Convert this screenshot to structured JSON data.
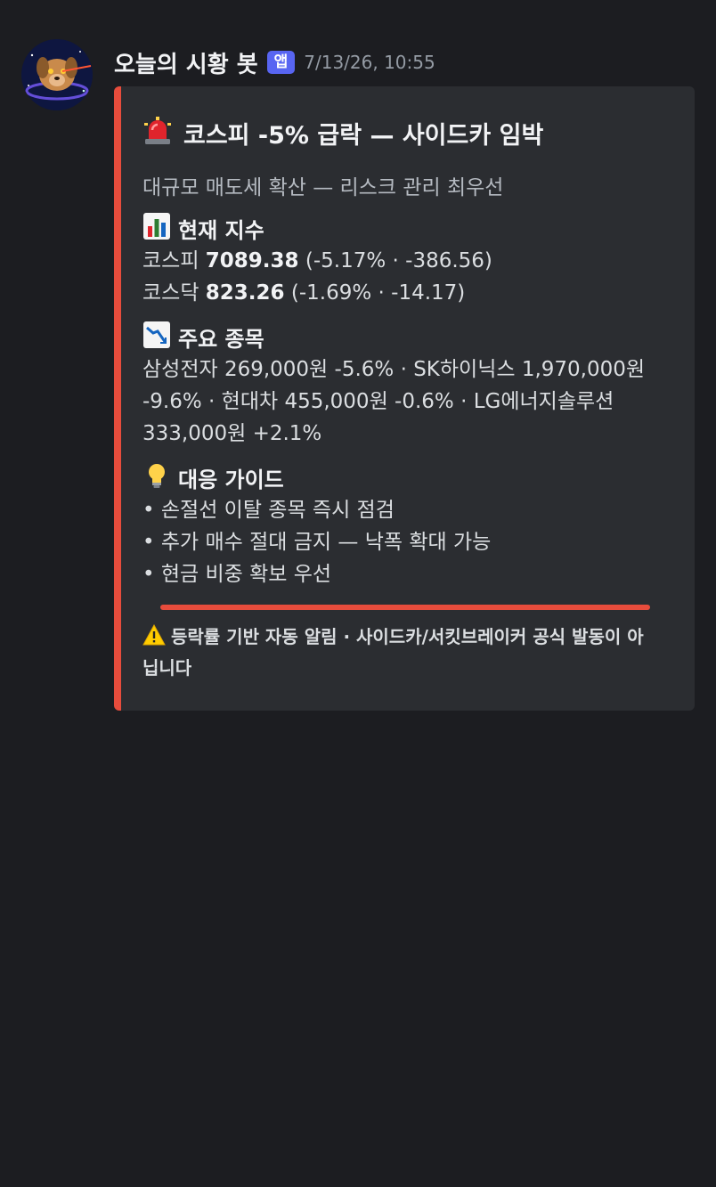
{
  "message": {
    "username": "오늘의 시황 봇",
    "badge": "앱",
    "timestamp": "7/13/26, 10:55"
  },
  "embed": {
    "accent_color": "#e74c3c",
    "title": "코스피 -5% 급락 — 사이드카 임박",
    "title_icon": "siren-icon",
    "subtitle": "대규모 매도세 확산 — 리스크 관리 최우선",
    "sections": {
      "index": {
        "icon": "bar-chart-icon",
        "title": "현재 지수",
        "kospi": {
          "label": "코스피",
          "value": "7089.38",
          "change": "(-5.17% · -386.56)"
        },
        "kosdaq": {
          "label": "코스닥",
          "value": "823.26",
          "change": "(-1.69% · -14.17)"
        }
      },
      "stocks": {
        "icon": "chart-decreasing-icon",
        "title": "주요 종목",
        "text": "삼성전자 269,000원 -5.6% · SK하이닉스 1,970,000원 -9.6% · 현대차 455,000원 -0.6% · LG에너지솔루션 333,000원 +2.1%"
      },
      "guide": {
        "icon": "lightbulb-icon",
        "title": "대응 가이드",
        "items": [
          "• 손절선 이탈 종목 즉시 점검",
          "• 추가 매수 절대 금지 — 낙폭 확대 가능",
          "• 현금 비중 확보 우선"
        ]
      }
    },
    "footer": {
      "icon": "warning-icon",
      "text": "등락률 기반 자동 알림 · 사이드카/서킷브레이커 공식 발동이 아닙니다"
    }
  }
}
